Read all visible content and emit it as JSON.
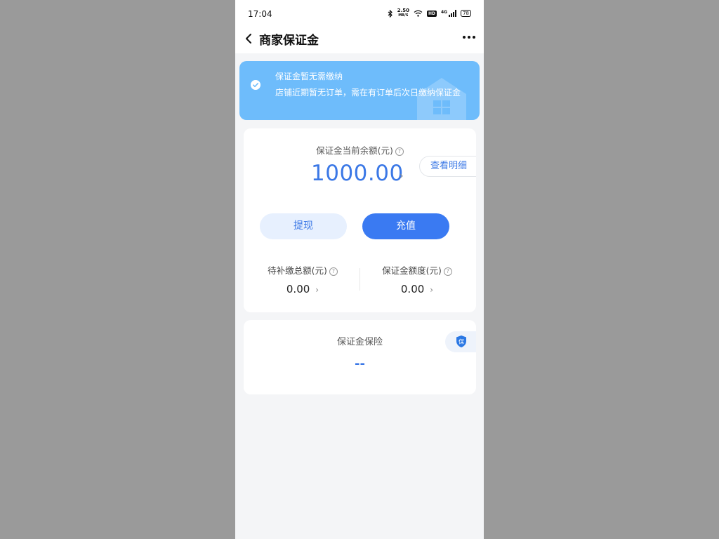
{
  "status_bar": {
    "time": "17:04",
    "net_speed_value": "2.50",
    "net_speed_unit": "MB/S",
    "hd_label": "HD",
    "network_label": "4G",
    "battery": "78"
  },
  "nav": {
    "title": "商家保证金"
  },
  "notice": {
    "title": "保证金暂无需缴纳",
    "text": "店铺近期暂无订单，需在有订单后次日缴纳保证金"
  },
  "balance": {
    "label": "保证金当前余额(元)",
    "help_symbol": "?",
    "amount": "1000.00",
    "detail_button": "查看明细",
    "withdraw_button": "提现",
    "recharge_button": "充值"
  },
  "stats": [
    {
      "label": "待补缴总额(元)",
      "value": "0.00"
    },
    {
      "label": "保证金额度(元)",
      "value": "0.00"
    }
  ],
  "insurance": {
    "label": "保证金保险",
    "value": "--",
    "badge_text": "保"
  },
  "colors": {
    "accent": "#3a7af2",
    "notice_bg": "#6ebcfb",
    "page_bg": "#f4f5f7",
    "outer_bg": "#9a9a9a"
  },
  "icons": [
    "bluetooth-icon",
    "wifi-icon",
    "signal-icon",
    "battery-icon",
    "back-icon",
    "more-icon",
    "check-circle-icon",
    "house-icon",
    "help-icon",
    "chevron-right-icon",
    "shield-icon"
  ]
}
